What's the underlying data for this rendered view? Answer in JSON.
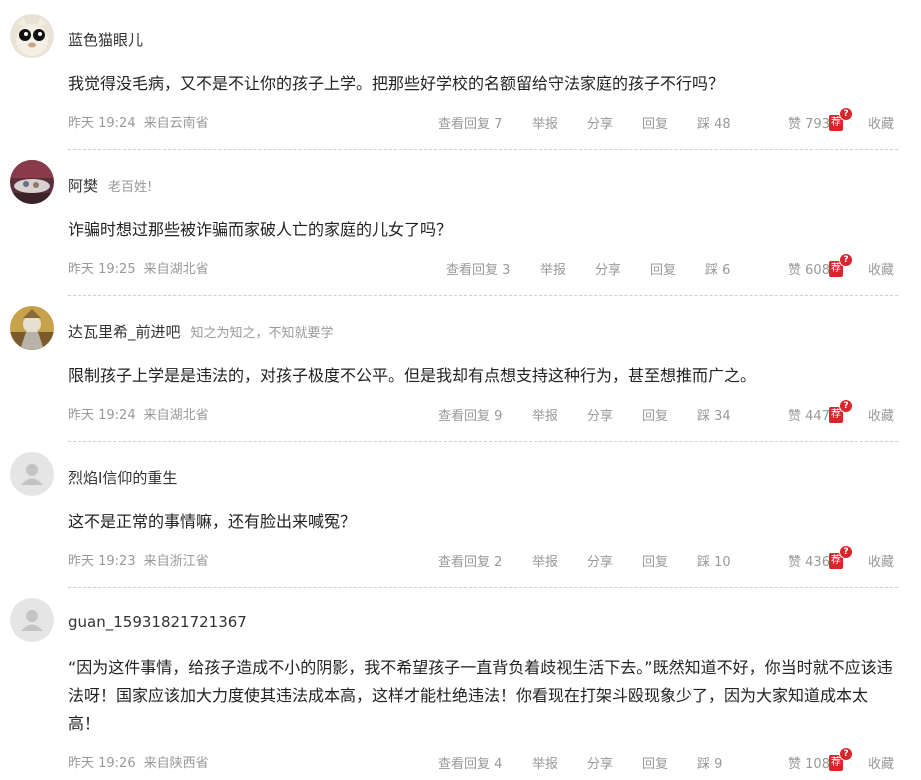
{
  "labels": {
    "reply": "查看回复",
    "report": "举报",
    "share": "分享",
    "answer": "回复",
    "down": "踩",
    "up": "赞",
    "recommend": "荐",
    "recommend_badge": "?",
    "favorite": "收藏"
  },
  "comments": [
    {
      "username": "蓝色猫眼儿",
      "tag": "",
      "text": "我觉得没毛病，又不是不让你的孩子上学。把那些好学校的名额留给守法家庭的孩子不行吗？",
      "time": "昨天 19:24",
      "location": "来自云南省",
      "replies": "7",
      "down": "48",
      "up": "793",
      "avatar": "cat-avatar"
    },
    {
      "username": "阿樊",
      "tag": "老百姓!",
      "text": "诈骗时想过那些被诈骗而家破人亡的家庭的儿女了吗？",
      "time": "昨天 19:25",
      "location": "来自湖北省",
      "replies": "3",
      "down": "6",
      "up": "608",
      "avatar": "photo-avatar"
    },
    {
      "username": "达瓦里希_前进吧",
      "tag": "知之为知之，不知就要学",
      "text": "限制孩子上学是是违法的，对孩子极度不公平。但是我却有点想支持这种行为，甚至想推而广之。",
      "time": "昨天 19:24",
      "location": "来自湖北省",
      "replies": "9",
      "down": "34",
      "up": "447",
      "avatar": "warrior-avatar"
    },
    {
      "username": "烈焰I信仰的重生",
      "tag": "",
      "text": "这不是正常的事情嘛，还有脸出来喊冤？",
      "time": "昨天 19:23",
      "location": "来自浙江省",
      "replies": "2",
      "down": "10",
      "up": "436",
      "avatar": "default-avatar"
    },
    {
      "username": "guan_15931821721367",
      "tag": "",
      "text": "“因为这件事情，给孩子造成不小的阴影，我不希望孩子一直背负着歧视生活下去。”既然知道不好，你当时就不应该违法呀！国家应该加大力度使其违法成本高，这样才能杜绝违法！你看现在打架斗殴现象少了，因为大家知道成本太高！",
      "time": "昨天 19:26",
      "location": "来自陕西省",
      "replies": "4",
      "down": "9",
      "up": "108",
      "avatar": "default-avatar"
    }
  ],
  "colors": {
    "recommend": "#d9252b",
    "meta": "#999999",
    "divider": "#cfcfcf"
  }
}
